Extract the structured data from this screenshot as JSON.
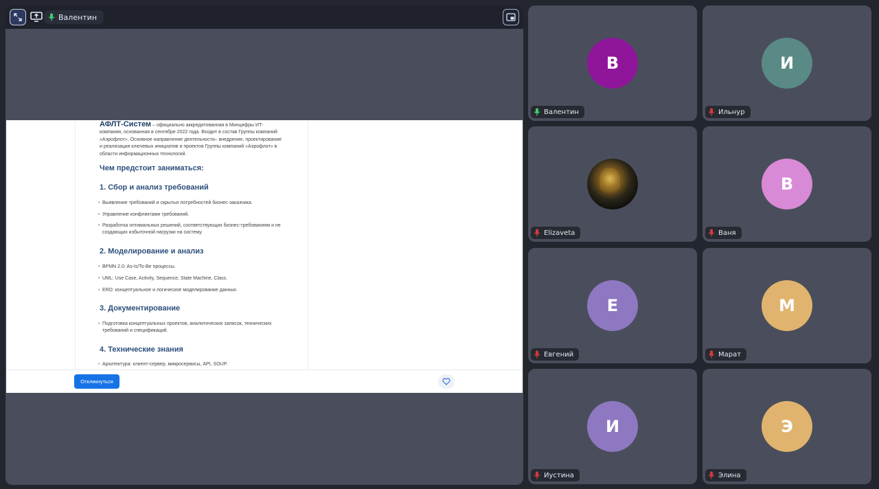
{
  "stage": {
    "speaker_name": "Валентин",
    "icons": {
      "collapse": "collapse-arrows-icon",
      "share": "screen-share-icon",
      "mic": "microphone-icon",
      "pip": "picture-in-picture-icon"
    }
  },
  "document": {
    "company_name": "АФЛТ-Систем",
    "intro": " – официально аккредитованная в Минцифры ИТ-компания, основанная в сентябре 2022 года. Входит в состав Группы компаний «Аэрофлот». Основное направление деятельности– внедрение, проектирование и реализация ключевых инициатив и проектов Группы компаний «Аэрофлот» в области информационных технологий.",
    "tasks_heading": "Чем предстоит заниматься:",
    "sections": [
      {
        "title": "1. Сбор и анализ требований",
        "items": [
          "Выявление требований и скрытых потребностей бизнес-заказчика.",
          "Управление конфликтами требований.",
          "Разработка оптимальных решений, соответствующих бизнес-требованиям и не создающих избыточной нагрузки на систему."
        ]
      },
      {
        "title": "2. Моделирование и анализ",
        "items": [
          "BPMN 2.0: As-Is/To-Be процессы.",
          "UML: Use Case, Activity, Sequence, State Machine, Class.",
          "ERD: концептуальное и логическое моделирование данных."
        ]
      },
      {
        "title": "3. Документирование",
        "items": [
          "Подготовка концептуальных проектов, аналитических записок, технических требований и спецификаций."
        ]
      },
      {
        "title": "4. Технические знания",
        "items": [
          "Архитектура: клиент-сервер, микросервисы, API, SOUP."
        ]
      }
    ],
    "apply_label": "Откликнуться",
    "favorite_icon": "heart-icon"
  },
  "participants": [
    {
      "name": "Валентин",
      "initial": "В",
      "color": "#8f169b",
      "mic": "on"
    },
    {
      "name": "Ильнур",
      "initial": "И",
      "color": "#5a8a86",
      "mic": "off"
    },
    {
      "name": "Elizaveta",
      "initial": "",
      "color": "",
      "mic": "off",
      "photo": true
    },
    {
      "name": "Ваня",
      "initial": "В",
      "color": "#d98ad6",
      "mic": "off"
    },
    {
      "name": "Евгений",
      "initial": "Е",
      "color": "#8e78c2",
      "mic": "off"
    },
    {
      "name": "Марат",
      "initial": "М",
      "color": "#e0b46e",
      "mic": "off"
    },
    {
      "name": "Иустина",
      "initial": "И",
      "color": "#8e78c2",
      "mic": "off"
    },
    {
      "name": "Элина",
      "initial": "Э",
      "color": "#e0b46e",
      "mic": "off"
    }
  ],
  "mic_colors": {
    "on": "#3fcf6a",
    "off": "#d63a3a"
  }
}
